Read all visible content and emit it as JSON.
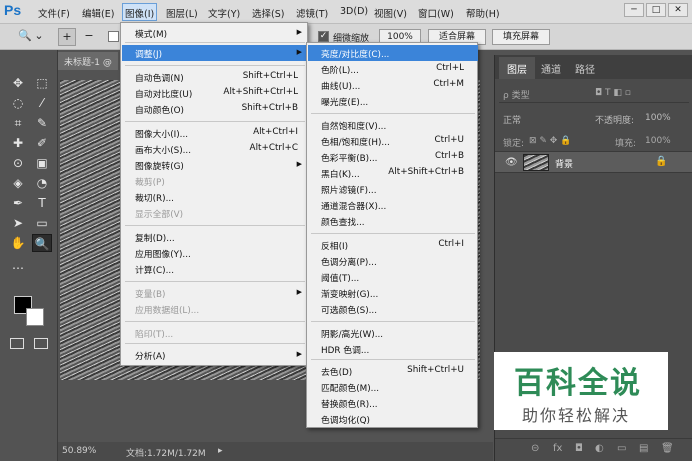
{
  "menubar": {
    "logo": "Ps",
    "items": [
      "文件(F)",
      "编辑(E)",
      "图像(I)",
      "图层(L)",
      "文字(Y)",
      "选择(S)",
      "滤镜(T)",
      "3D(D)",
      "视图(V)",
      "窗口(W)",
      "帮助(H)"
    ],
    "window_buttons": [
      "─",
      "□",
      "✕"
    ]
  },
  "options": {
    "tool_icon": "🔍",
    "arrow": "⌄",
    "zoom_in": "+",
    "zoom_out": "−",
    "fine_zoom": "细微缩放",
    "zoom_value": "100%",
    "fit_screen": "适合屏幕",
    "fill_screen": "填充屏幕",
    "check": "✓"
  },
  "document": {
    "tab": "未标题-1 @",
    "zoom": "50.89%",
    "doc_info": "文档:1.72M/1.72M",
    "status_arrow": "▸"
  },
  "tools": [
    "✥",
    "⬚",
    "◌",
    "⁄",
    "⌗",
    "✎",
    "✚",
    "✐",
    "⊙",
    "▣",
    "◈",
    "◔",
    "✒",
    "T",
    "➤",
    "▭",
    "✋",
    "🔍",
    "…"
  ],
  "panel": {
    "tabs": [
      "图层",
      "通道",
      "路径"
    ],
    "filter_label": "ρ 类型",
    "filter_icons": "◘ T ◧ ▫",
    "mode": "正常",
    "opacity_label": "不透明度:",
    "opacity": "100%",
    "lock_label": "锁定:",
    "lock_icons": "⊠ ✎ ✥ 🔒",
    "fill_label": "填充:",
    "fill": "100%",
    "layer_name": "背景",
    "layer_eye": "👁",
    "layer_lock": "🔒",
    "bottom_icons": [
      "⊝",
      "fx",
      "◘",
      "◐",
      "▭",
      "▤",
      "🗑"
    ]
  },
  "image_menu": {
    "items": [
      {
        "label": "模式(M)",
        "shortcut": "",
        "sub": true,
        "disabled": false
      },
      {
        "label": "调整(J)",
        "shortcut": "",
        "sub": true,
        "disabled": false,
        "hi": true
      },
      {
        "label": "自动色调(N)",
        "shortcut": "Shift+Ctrl+L"
      },
      {
        "label": "自动对比度(U)",
        "shortcut": "Alt+Shift+Ctrl+L"
      },
      {
        "label": "自动颜色(O)",
        "shortcut": "Shift+Ctrl+B"
      },
      {
        "label": "图像大小(I)...",
        "shortcut": "Alt+Ctrl+I"
      },
      {
        "label": "画布大小(S)...",
        "shortcut": "Alt+Ctrl+C"
      },
      {
        "label": "图像旋转(G)",
        "shortcut": "",
        "sub": true
      },
      {
        "label": "裁剪(P)",
        "shortcut": "",
        "disabled": true
      },
      {
        "label": "裁切(R)...",
        "shortcut": ""
      },
      {
        "label": "显示全部(V)",
        "shortcut": "",
        "disabled": true
      },
      {
        "label": "复制(D)...",
        "shortcut": ""
      },
      {
        "label": "应用图像(Y)...",
        "shortcut": ""
      },
      {
        "label": "计算(C)...",
        "shortcut": ""
      },
      {
        "label": "变量(B)",
        "shortcut": "",
        "sub": true,
        "disabled": true
      },
      {
        "label": "应用数据组(L)...",
        "shortcut": "",
        "disabled": true
      },
      {
        "label": "陷印(T)...",
        "shortcut": "",
        "disabled": true
      },
      {
        "label": "分析(A)",
        "shortcut": "",
        "sub": true
      }
    ]
  },
  "adjust_menu": {
    "items": [
      {
        "label": "亮度/对比度(C)...",
        "shortcut": "",
        "hi": true
      },
      {
        "label": "色阶(L)...",
        "shortcut": "Ctrl+L"
      },
      {
        "label": "曲线(U)...",
        "shortcut": "Ctrl+M"
      },
      {
        "label": "曝光度(E)...",
        "shortcut": ""
      },
      {
        "label": "自然饱和度(V)...",
        "shortcut": ""
      },
      {
        "label": "色相/饱和度(H)...",
        "shortcut": "Ctrl+U"
      },
      {
        "label": "色彩平衡(B)...",
        "shortcut": "Ctrl+B"
      },
      {
        "label": "黑白(K)...",
        "shortcut": "Alt+Shift+Ctrl+B"
      },
      {
        "label": "照片滤镜(F)...",
        "shortcut": ""
      },
      {
        "label": "通道混合器(X)...",
        "shortcut": ""
      },
      {
        "label": "颜色查找...",
        "shortcut": ""
      },
      {
        "label": "反相(I)",
        "shortcut": "Ctrl+I"
      },
      {
        "label": "色调分离(P)...",
        "shortcut": ""
      },
      {
        "label": "阈值(T)...",
        "shortcut": ""
      },
      {
        "label": "渐变映射(G)...",
        "shortcut": ""
      },
      {
        "label": "可选颜色(S)...",
        "shortcut": ""
      },
      {
        "label": "阴影/高光(W)...",
        "shortcut": ""
      },
      {
        "label": "HDR 色调...",
        "shortcut": ""
      },
      {
        "label": "去色(D)",
        "shortcut": "Shift+Ctrl+U"
      },
      {
        "label": "匹配颜色(M)...",
        "shortcut": ""
      },
      {
        "label": "替换颜色(R)...",
        "shortcut": ""
      },
      {
        "label": "色调均化(Q)",
        "shortcut": ""
      }
    ]
  },
  "watermark": {
    "title": "百科全说",
    "subtitle": "助你轻松解决"
  }
}
